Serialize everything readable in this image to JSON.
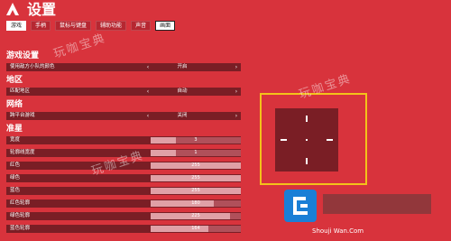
{
  "header": {
    "title": "设置"
  },
  "tabs": [
    {
      "label": "游戏"
    },
    {
      "label": "手柄"
    },
    {
      "label": "鼠标与键盘"
    },
    {
      "label": "辅助功能"
    },
    {
      "label": "声音"
    },
    {
      "label": "画面"
    }
  ],
  "sections": {
    "game_settings": "游戏设置",
    "region": "地区",
    "network": "网络",
    "crosshair": "准星"
  },
  "rows": {
    "enemy_color": {
      "label": "使用敌方小队的颜色",
      "value": "开启"
    },
    "match_region": {
      "label": "匹配地区",
      "value": "自动"
    },
    "crossplay": {
      "label": "跨平台游戏",
      "value": "关闭"
    },
    "width": {
      "label": "宽度",
      "value": "3",
      "level": 0.28
    },
    "outline_width": {
      "label": "轮廓线宽度",
      "value": "1",
      "level": 0.28
    },
    "red": {
      "label": "红色",
      "value": "255",
      "level": 1.0
    },
    "green": {
      "label": "绿色",
      "value": "255",
      "level": 1.0
    },
    "blue": {
      "label": "蓝色",
      "value": "255",
      "level": 1.0
    },
    "outline_red": {
      "label": "红色轮廓",
      "value": "180",
      "level": 0.7
    },
    "outline_green": {
      "label": "绿色轮廓",
      "value": "225",
      "level": 0.88
    },
    "outline_blue": {
      "label": "蓝色轮廓",
      "value": "164",
      "level": 0.64
    }
  },
  "watermarks": {
    "text1": "玩咖宝典",
    "text2": "玩咖宝典",
    "text3": "玩咖宝典"
  },
  "site": {
    "url": "Shouji Wan.Com"
  },
  "colors": {
    "background": "#d8333c",
    "row": "#7a1e25",
    "preview_border": "#f3c21a"
  }
}
